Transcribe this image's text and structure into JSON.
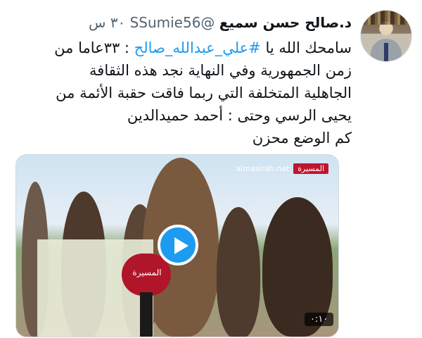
{
  "tweet": {
    "display_name": "د.صالح حسن سميع",
    "handle": "@SSumie56",
    "time": "٣٠ س",
    "text_lines": [
      "سامحك الله يا #علي_عبدالله_صالح : ٣٣عاما من",
      "زمن الجمهورية وفي النهاية نجد هذه الثقافة",
      "الجاهلية المتخلفة التي ربما فاقت حقبة الأئمة من",
      "يحيى الرسي وحتى : أحمد حميدالدين",
      "كم الوضع محزن"
    ],
    "hashtag": "#علي_عبدالله_صالح"
  },
  "media": {
    "watermark_site": "almasirah.net",
    "watermark_logo": "المسيرة",
    "mic_label": "المسيرة",
    "duration": "٠:١٠",
    "play_icon": "play-icon",
    "colors": {
      "play": "#1d9bf0",
      "logo": "#c0152f"
    }
  }
}
